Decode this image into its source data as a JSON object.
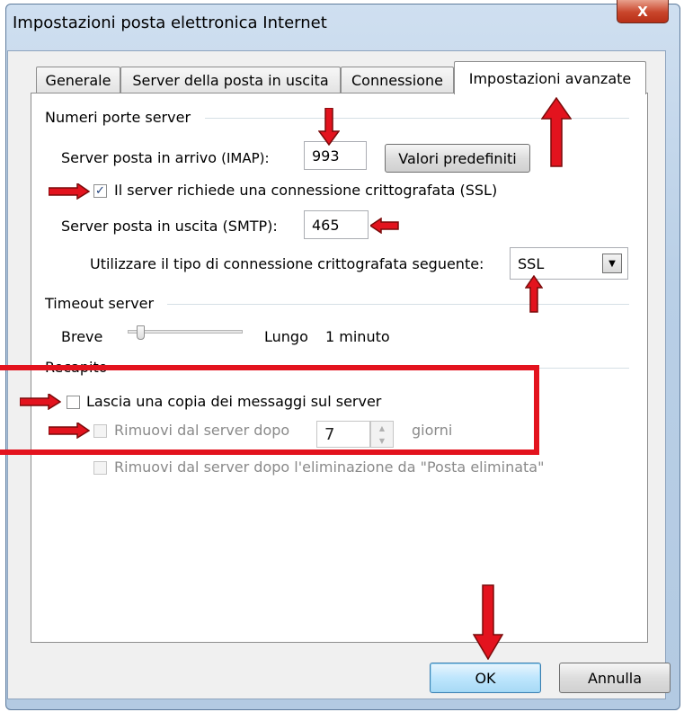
{
  "window": {
    "title": "Impostazioni posta elettronica Internet",
    "close_symbol": "X"
  },
  "tabs": [
    {
      "label": "Generale"
    },
    {
      "label": "Server della posta in uscita"
    },
    {
      "label": "Connessione"
    },
    {
      "label": "Impostazioni avanzate",
      "active": true
    }
  ],
  "ports": {
    "group_label": "Numeri porte server",
    "incoming_label": "Server posta in arrivo",
    "incoming_protocol": "(IMAP):",
    "incoming_value": "993",
    "defaults_button": "Valori predefiniti",
    "ssl_checkbox_label": "Il server richiede una connessione crittografata (SSL)",
    "ssl_checked": true,
    "check_mark": "✓",
    "outgoing_label": "Server posta in uscita (SMTP):",
    "outgoing_value": "465",
    "encryption_label": "Utilizzare il tipo di connessione crittografata seguente:",
    "encryption_value": "SSL"
  },
  "timeout": {
    "group_label": "Timeout server",
    "short_label": "Breve",
    "long_label": "Lungo",
    "value": "1 minuto"
  },
  "delivery": {
    "group_label": "Recapito",
    "leave_copy_label": "Lascia una copia dei messaggi sul server",
    "remove_after_label": "Rimuovi dal server dopo",
    "days_value": "7",
    "days_unit": "giorni",
    "remove_deleted_label": "Rimuovi dal server dopo l'eliminazione da \"Posta eliminata\""
  },
  "footer": {
    "ok_button": "OK",
    "cancel_button": "Annulla"
  },
  "colors": {
    "annotation_red": "#e3131e"
  }
}
